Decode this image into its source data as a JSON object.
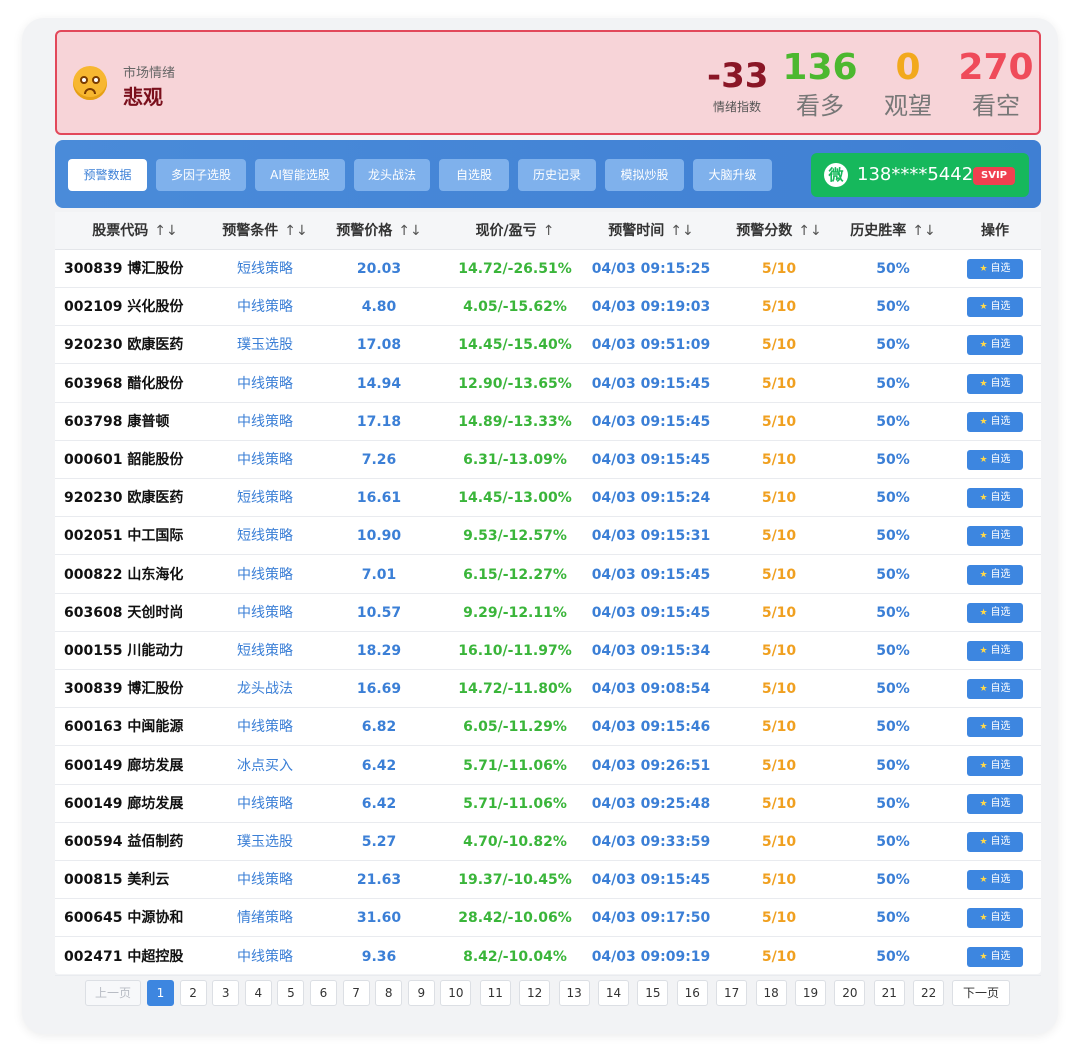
{
  "sentiment": {
    "label": "市场情绪",
    "value": "悲观",
    "index_value": "-33",
    "index_label": "情绪指数",
    "stats": [
      {
        "num": "136",
        "label": "看多",
        "color": "#4cb82f"
      },
      {
        "num": "0",
        "label": "观望",
        "color": "#f2a91d"
      },
      {
        "num": "270",
        "label": "看空",
        "color": "#ef4b5a"
      }
    ]
  },
  "tabs": [
    "预警数据",
    "多因子选股",
    "AI智能选股",
    "龙头战法",
    "自选股",
    "历史记录",
    "模拟炒股",
    "大脑升级"
  ],
  "account": {
    "icon": "微",
    "phone": "138****5442",
    "badge": "SVIP"
  },
  "table": {
    "headers": [
      {
        "label": "股票代码",
        "sort": "↑↓"
      },
      {
        "label": "预警条件",
        "sort": "↑↓"
      },
      {
        "label": "预警价格",
        "sort": "↑↓"
      },
      {
        "label": "现价/盈亏",
        "sort": "↑"
      },
      {
        "label": "预警时间",
        "sort": "↑↓"
      },
      {
        "label": "预警分数",
        "sort": "↑↓"
      },
      {
        "label": "历史胜率",
        "sort": "↑↓"
      },
      {
        "label": "操作",
        "sort": ""
      }
    ],
    "action_label": "自选",
    "rows": [
      {
        "stock": "300839 博汇股份",
        "cond": "短线策略",
        "price": "20.03",
        "now": "14.72/-26.51%",
        "time": "04/03 09:15:25",
        "score": "5/10",
        "win": "50%"
      },
      {
        "stock": "002109 兴化股份",
        "cond": "中线策略",
        "price": "4.80",
        "now": "4.05/-15.62%",
        "time": "04/03 09:19:03",
        "score": "5/10",
        "win": "50%"
      },
      {
        "stock": "920230 欧康医药",
        "cond": "璞玉选股",
        "price": "17.08",
        "now": "14.45/-15.40%",
        "time": "04/03 09:51:09",
        "score": "5/10",
        "win": "50%"
      },
      {
        "stock": "603968 醋化股份",
        "cond": "中线策略",
        "price": "14.94",
        "now": "12.90/-13.65%",
        "time": "04/03 09:15:45",
        "score": "5/10",
        "win": "50%"
      },
      {
        "stock": "603798 康普顿",
        "cond": "中线策略",
        "price": "17.18",
        "now": "14.89/-13.33%",
        "time": "04/03 09:15:45",
        "score": "5/10",
        "win": "50%"
      },
      {
        "stock": "000601 韶能股份",
        "cond": "中线策略",
        "price": "7.26",
        "now": "6.31/-13.09%",
        "time": "04/03 09:15:45",
        "score": "5/10",
        "win": "50%"
      },
      {
        "stock": "920230 欧康医药",
        "cond": "短线策略",
        "price": "16.61",
        "now": "14.45/-13.00%",
        "time": "04/03 09:15:24",
        "score": "5/10",
        "win": "50%"
      },
      {
        "stock": "002051 中工国际",
        "cond": "短线策略",
        "price": "10.90",
        "now": "9.53/-12.57%",
        "time": "04/03 09:15:31",
        "score": "5/10",
        "win": "50%"
      },
      {
        "stock": "000822 山东海化",
        "cond": "中线策略",
        "price": "7.01",
        "now": "6.15/-12.27%",
        "time": "04/03 09:15:45",
        "score": "5/10",
        "win": "50%"
      },
      {
        "stock": "603608 天创时尚",
        "cond": "中线策略",
        "price": "10.57",
        "now": "9.29/-12.11%",
        "time": "04/03 09:15:45",
        "score": "5/10",
        "win": "50%"
      },
      {
        "stock": "000155 川能动力",
        "cond": "短线策略",
        "price": "18.29",
        "now": "16.10/-11.97%",
        "time": "04/03 09:15:34",
        "score": "5/10",
        "win": "50%"
      },
      {
        "stock": "300839 博汇股份",
        "cond": "龙头战法",
        "price": "16.69",
        "now": "14.72/-11.80%",
        "time": "04/03 09:08:54",
        "score": "5/10",
        "win": "50%"
      },
      {
        "stock": "600163 中闽能源",
        "cond": "中线策略",
        "price": "6.82",
        "now": "6.05/-11.29%",
        "time": "04/03 09:15:46",
        "score": "5/10",
        "win": "50%"
      },
      {
        "stock": "600149 廊坊发展",
        "cond": "冰点买入",
        "price": "6.42",
        "now": "5.71/-11.06%",
        "time": "04/03 09:26:51",
        "score": "5/10",
        "win": "50%"
      },
      {
        "stock": "600149 廊坊发展",
        "cond": "中线策略",
        "price": "6.42",
        "now": "5.71/-11.06%",
        "time": "04/03 09:25:48",
        "score": "5/10",
        "win": "50%"
      },
      {
        "stock": "600594 益佰制药",
        "cond": "璞玉选股",
        "price": "5.27",
        "now": "4.70/-10.82%",
        "time": "04/03 09:33:59",
        "score": "5/10",
        "win": "50%"
      },
      {
        "stock": "000815 美利云",
        "cond": "中线策略",
        "price": "21.63",
        "now": "19.37/-10.45%",
        "time": "04/03 09:15:45",
        "score": "5/10",
        "win": "50%"
      },
      {
        "stock": "600645 中源协和",
        "cond": "情绪策略",
        "price": "31.60",
        "now": "28.42/-10.06%",
        "time": "04/03 09:17:50",
        "score": "5/10",
        "win": "50%"
      },
      {
        "stock": "002471 中超控股",
        "cond": "中线策略",
        "price": "9.36",
        "now": "8.42/-10.04%",
        "time": "04/03 09:09:19",
        "score": "5/10",
        "win": "50%"
      }
    ]
  },
  "pagination": {
    "prev": "上一页",
    "next": "下一页",
    "pages": [
      "1",
      "2",
      "3",
      "4",
      "5",
      "6",
      "7",
      "8",
      "9",
      "10",
      "11",
      "12",
      "13",
      "14",
      "15",
      "16",
      "17",
      "18",
      "19",
      "20",
      "21",
      "22"
    ],
    "current": "1"
  }
}
